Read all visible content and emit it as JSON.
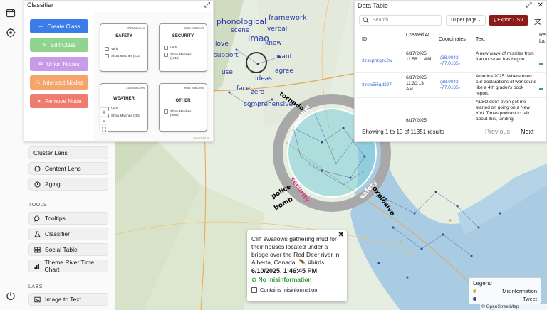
{
  "rail": {
    "icons": [
      "calendar-icon",
      "target-icon",
      "power-icon"
    ]
  },
  "sidebar": {
    "lenses": [
      {
        "label": "Cluster Lens",
        "icon": "none"
      },
      {
        "label": "Content Lens",
        "icon": "circle-icon"
      },
      {
        "label": "Aging",
        "icon": "clock-icon"
      }
    ],
    "tools_header": "TOOLS",
    "tools": [
      {
        "label": "Tooltips",
        "icon": "chat-icon"
      },
      {
        "label": "Classifier",
        "icon": "flask-icon"
      },
      {
        "label": "Social Table",
        "icon": "table-icon"
      },
      {
        "label": "Theme River Time Chart",
        "icon": "chart-icon"
      }
    ],
    "labs_header": "LABS",
    "labs": [
      {
        "label": "Image to Text",
        "icon": "image-icon"
      }
    ]
  },
  "classifier": {
    "title": "Classifier",
    "buttons": [
      {
        "label": "Create Class",
        "color": "#3b7de8"
      },
      {
        "label": "Edit Class",
        "color": "#8fd58f"
      },
      {
        "label": "Union Nodes",
        "color": "#c79be8"
      },
      {
        "label": "Intersect Nodes",
        "color": "#f5a56b"
      },
      {
        "label": "Remove Node",
        "color": "#f07c6f"
      }
    ],
    "nodes": [
      {
        "title": "SAFETY",
        "count": "472 Matches",
        "rows": [
          "Verb",
          "Show Matches (472)"
        ]
      },
      {
        "title": "SECURITY",
        "count": "1018 Matches",
        "rows": [
          "Verb",
          "Show Matches (1018)"
        ]
      },
      {
        "title": "WEATHER",
        "count": "205 Matches",
        "rows": [
          "Verb",
          "Show Matches (205)"
        ]
      },
      {
        "title": "OTHER",
        "count": "9662 Matches",
        "rows": [
          "Show Matches (9662)"
        ]
      }
    ],
    "zoom": [
      "+",
      "−",
      "⛶"
    ],
    "footer": "React Flow"
  },
  "datatable": {
    "title": "Data Table",
    "search_placeholder": "Search...",
    "per_page": "10 per page",
    "export_label": "Export CSV",
    "columns": [
      "ID",
      "Created At",
      "Coordinates",
      "Text",
      "Re La"
    ],
    "rows": [
      {
        "id": "3lrsxphzgzc2w",
        "created": "6/17/2025 11:58:11 AM",
        "coords": "(38.9042, -77.0165)",
        "text": "A new wave of missiles from Iran to Israel has begun."
      },
      {
        "id": "3lrsw5i5qd227",
        "created": "6/17/2025 11:30:13 AM",
        "coords": "(38.9042, -77.0165)",
        "text": "America 2025: Where even our declarations of war sound like a 4th grader's book report."
      },
      {
        "id": "",
        "created": "6/17/2025",
        "coords": "",
        "text": "ALSO don't even get me started on going on a New York Times podcast to talk about this, landing"
      }
    ],
    "footer_text": "Showing 1 to 10 of 11351 results",
    "prev_label": "Previous",
    "next_label": "Next"
  },
  "map": {
    "words": [
      {
        "t": "phonological",
        "c": "#2a3aa8"
      },
      {
        "t": "framework",
        "c": "#2a3aa8"
      },
      {
        "t": "scene",
        "c": "#2a3aa8"
      },
      {
        "t": "lmao",
        "c": "#2a3aa8"
      },
      {
        "t": "verbal",
        "c": "#2a3aa8"
      },
      {
        "t": "love",
        "c": "#2a3aa8"
      },
      {
        "t": "know",
        "c": "#2a3aa8"
      },
      {
        "t": "support",
        "c": "#2a3aa8"
      },
      {
        "t": "want",
        "c": "#2a3aa8"
      },
      {
        "t": "use",
        "c": "#2a3aa8"
      },
      {
        "t": "agree",
        "c": "#2a3aa8"
      },
      {
        "t": "ideas",
        "c": "#2a3aa8"
      },
      {
        "t": "face",
        "c": "#2a3aa8"
      },
      {
        "t": "zero",
        "c": "#2a3aa8"
      },
      {
        "t": "comprehensive",
        "c": "#2a3aa8"
      },
      {
        "t": "tornado",
        "c": "#000"
      },
      {
        "t": "weather",
        "c": "#fff"
      },
      {
        "t": "security",
        "c": "#e0338a"
      },
      {
        "t": "safety",
        "c": "#fff"
      },
      {
        "t": "explosive",
        "c": "#000"
      },
      {
        "t": "police",
        "c": "#000"
      },
      {
        "t": "bomb",
        "c": "#000"
      }
    ],
    "attribution": "© OpenStreetMap contributors."
  },
  "popup": {
    "text": "Cliff swallows gathering mud for their houses located under a bridge over the Red Deer river in Alberta, Canada. 🪶 #birds",
    "date": "6/10/2025, 1:46:45 PM",
    "misinfo": "No misinformation",
    "checkbox_label": "Contains misinformation"
  },
  "legend": {
    "title": "Legend",
    "items": [
      {
        "label": "Misinformation",
        "color": "#c9b85a"
      },
      {
        "label": "Tweet",
        "color": "#3b3f8f"
      }
    ]
  }
}
